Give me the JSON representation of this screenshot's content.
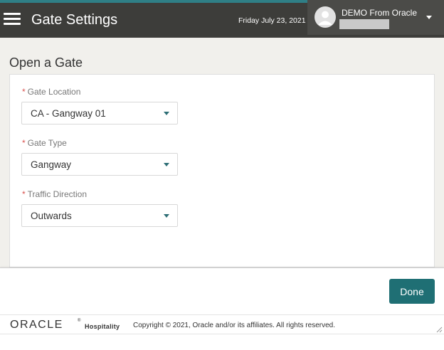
{
  "header": {
    "title": "Gate Settings",
    "date": "Friday July 23, 2021",
    "user_name": "DEMO From Oracle",
    "icons": {
      "menu": "hamburger-menu-icon",
      "avatar": "user-avatar-icon",
      "user_menu": "chevron-down-icon"
    }
  },
  "page": {
    "title": "Open a Gate"
  },
  "form": {
    "required_marker": "*",
    "fields": [
      {
        "label": "Gate Location",
        "value": "CA - Gangway 01"
      },
      {
        "label": "Gate Type",
        "value": "Gangway"
      },
      {
        "label": "Traffic Direction",
        "value": "Outwards"
      }
    ]
  },
  "footer": {
    "done_label": "Done"
  },
  "copyright": {
    "brand": "ORACLE",
    "trademark": "®",
    "product": "Hospitality",
    "text": "Copyright © 2021, Oracle and/or its affiliates. All rights reserved."
  },
  "colors": {
    "header_bg": "#3d3d3a",
    "accent_strip": "#2f7f86",
    "primary_button": "#1f6f74",
    "required": "#d9534f",
    "content_bg": "#f1f0ec"
  }
}
